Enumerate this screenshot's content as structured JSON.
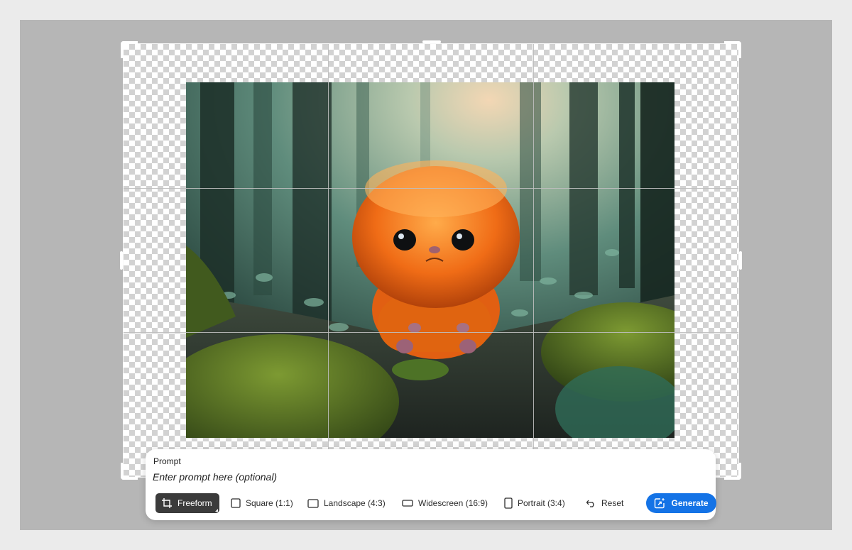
{
  "prompt": {
    "label": "Prompt",
    "placeholder": "Enter prompt here (optional)",
    "value": ""
  },
  "toolbar": {
    "freeform": {
      "label": "Freeform",
      "icon": "crop-icon",
      "selected": true
    },
    "square": {
      "label": "Square (1:1)",
      "icon": "square-icon"
    },
    "landscape": {
      "label": "Landscape (4:3)",
      "icon": "landscape-icon"
    },
    "widescreen": {
      "label": "Widescreen (16:9)",
      "icon": "widescreen-icon"
    },
    "portrait": {
      "label": "Portrait (3:4)",
      "icon": "portrait-icon"
    },
    "reset": {
      "label": "Reset",
      "icon": "undo-icon"
    },
    "generate": {
      "label": "Generate",
      "icon": "generative-expand-icon"
    }
  },
  "colors": {
    "accent": "#1473e6",
    "active_tool": "#3b3b3b",
    "workspace": "#b6b6b6"
  }
}
